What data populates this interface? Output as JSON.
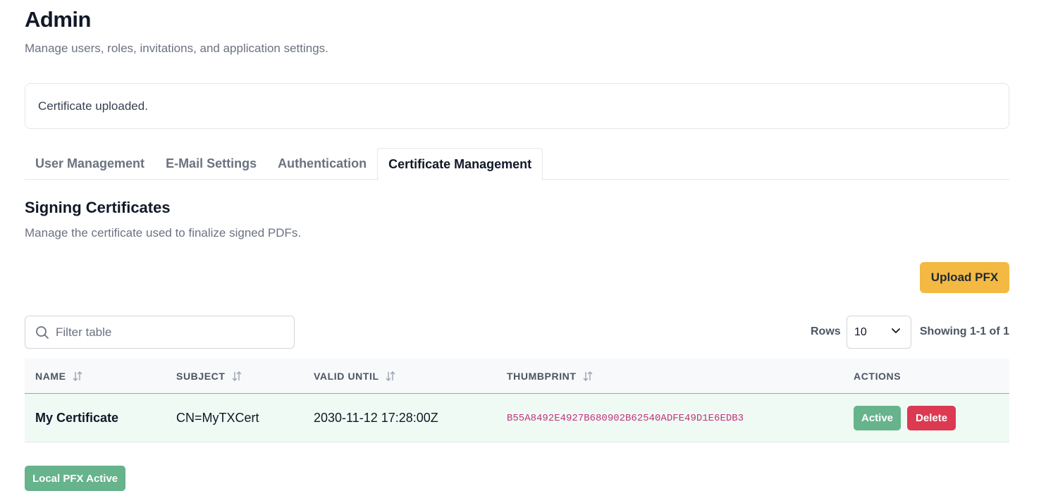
{
  "header": {
    "title": "Admin",
    "subtitle": "Manage users, roles, invitations, and application settings."
  },
  "alert": {
    "message": "Certificate uploaded."
  },
  "tabs": [
    {
      "label": "User Management",
      "active": false
    },
    {
      "label": "E-Mail Settings",
      "active": false
    },
    {
      "label": "Authentication",
      "active": false
    },
    {
      "label": "Certificate Management",
      "active": true
    }
  ],
  "section": {
    "title": "Signing Certificates",
    "subtitle": "Manage the certificate used to finalize signed PDFs.",
    "upload_label": "Upload PFX"
  },
  "toolbar": {
    "search_placeholder": "Filter table",
    "rows_label": "Rows",
    "rows_value": "10",
    "showing_text": "Showing 1-1 of 1"
  },
  "table": {
    "columns": [
      "NAME",
      "SUBJECT",
      "VALID UNTIL",
      "THUMBPRINT",
      "ACTIONS"
    ],
    "rows": [
      {
        "name": "My Certificate",
        "subject": "CN=MyTXCert",
        "valid_until": "2030-11-12 17:28:00Z",
        "thumbprint": "B55A8492E4927B680902B62540ADFE49D1E6EDB3",
        "active_label": "Active",
        "delete_label": "Delete"
      }
    ]
  },
  "footer": {
    "badge_label": "Local PFX Active"
  },
  "colors": {
    "accent_upload": "#f4b942",
    "active_green": "#66b38c",
    "delete_red": "#dc3a52",
    "thumbprint_pink": "#c0347a",
    "row_highlight": "#effaf4"
  }
}
